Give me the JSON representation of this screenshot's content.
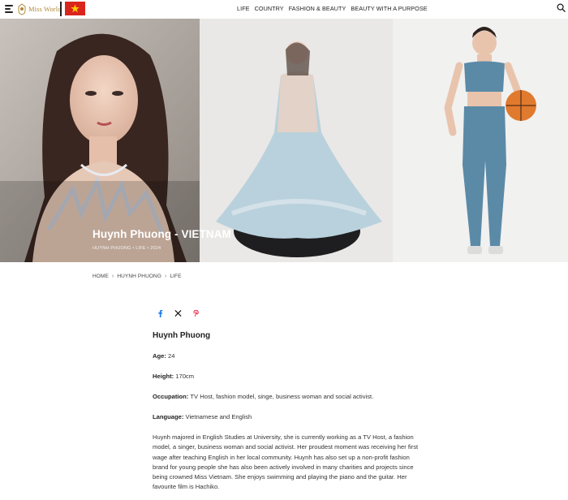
{
  "header": {
    "brand_name": "Miss World",
    "flag_country": "Vietnam",
    "nav": [
      "LIFE",
      "COUNTRY",
      "FASHION & BEAUTY",
      "BEAUTY WITH A PURPOSE"
    ],
    "icons": {
      "menu": "hamburger-menu-icon",
      "search": "search-icon",
      "flag": "vietnam-flag-icon"
    }
  },
  "hero": {
    "title": "Huynh Phuong - VIETNAM",
    "meta": "HUYNH PHUONG • LIFE • 2024"
  },
  "breadcrumb": [
    "HOME",
    "HUYNH PHUONG",
    "LIFE"
  ],
  "share": {
    "icons": [
      "facebook-icon",
      "x-icon",
      "pinterest-icon"
    ],
    "colors": {
      "facebook": "#1877f2",
      "x": "#111111",
      "pinterest": "#e60023"
    }
  },
  "article": {
    "name": "Huynh Phuong",
    "facts": [
      {
        "label": "Age:",
        "value": "24"
      },
      {
        "label": "Height:",
        "value": "170cm"
      },
      {
        "label": "Occupation:",
        "value": "TV Host, fashion model, singe, business woman and social activist."
      },
      {
        "label": "Language:",
        "value": "Vietnamese and English"
      }
    ],
    "bio": "Huynh majored in English Studies at University, she is currently working as a TV Host, a fashion model, a singer, business woman and social activist. Her proudest moment was receiving her first wage after teaching English in her local community. Huynh has also set up a non-profit fashion brand for young people she has also been actively involved in many charities and projects since being crowned Miss Vietnam. She enjoys swimming and playing the piano and the guitar. Her favourite film is Hachiko."
  },
  "colors": {
    "flag_red": "#da251d",
    "flag_star": "#ffcd00",
    "brand_gold": "#b08a3a"
  }
}
